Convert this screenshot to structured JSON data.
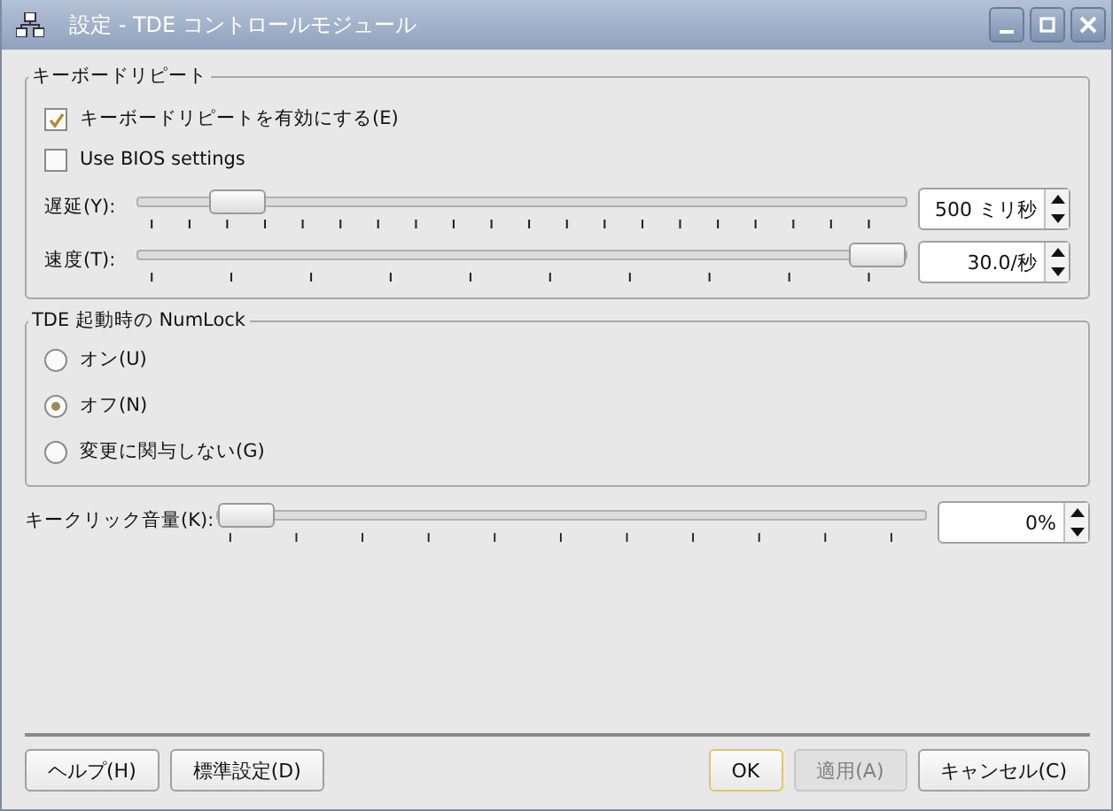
{
  "window": {
    "title": "設定 - TDE コントロールモジュール"
  },
  "keyboard_repeat": {
    "title": "キーボードリピート",
    "checkboxes": [
      {
        "label": "キーボードリピートを有効にする(E)",
        "checked": true
      },
      {
        "label": "Use BIOS settings",
        "checked": false
      }
    ],
    "sliders": [
      {
        "label": "遅延(Y):",
        "level": 0.1,
        "value": "500 ミリ秒"
      },
      {
        "label": "速度(T):",
        "level": 1,
        "value": "30.0/秒"
      }
    ]
  },
  "numlock": {
    "title": "TDE 起動時の NumLock",
    "options": [
      {
        "label": "オン(U)",
        "selected": false
      },
      {
        "label": "オフ(N)",
        "selected": true
      },
      {
        "label": "変更に関与しない(G)",
        "selected": false
      }
    ]
  },
  "key_click": {
    "label": "キークリック音量(K):",
    "level": 0,
    "value": "0%"
  },
  "left_buttons": [
    {
      "label": "ヘルプ(H)",
      "disabled": false,
      "focused": false
    },
    {
      "label": "標準設定(D)",
      "disabled": false,
      "focused": false
    }
  ],
  "right_buttons": [
    {
      "label": "OK",
      "disabled": false,
      "focused": true
    },
    {
      "label": "適用(A)",
      "disabled": true,
      "focused": false
    },
    {
      "label": "キャンセル(C)",
      "disabled": false,
      "focused": false
    }
  ]
}
